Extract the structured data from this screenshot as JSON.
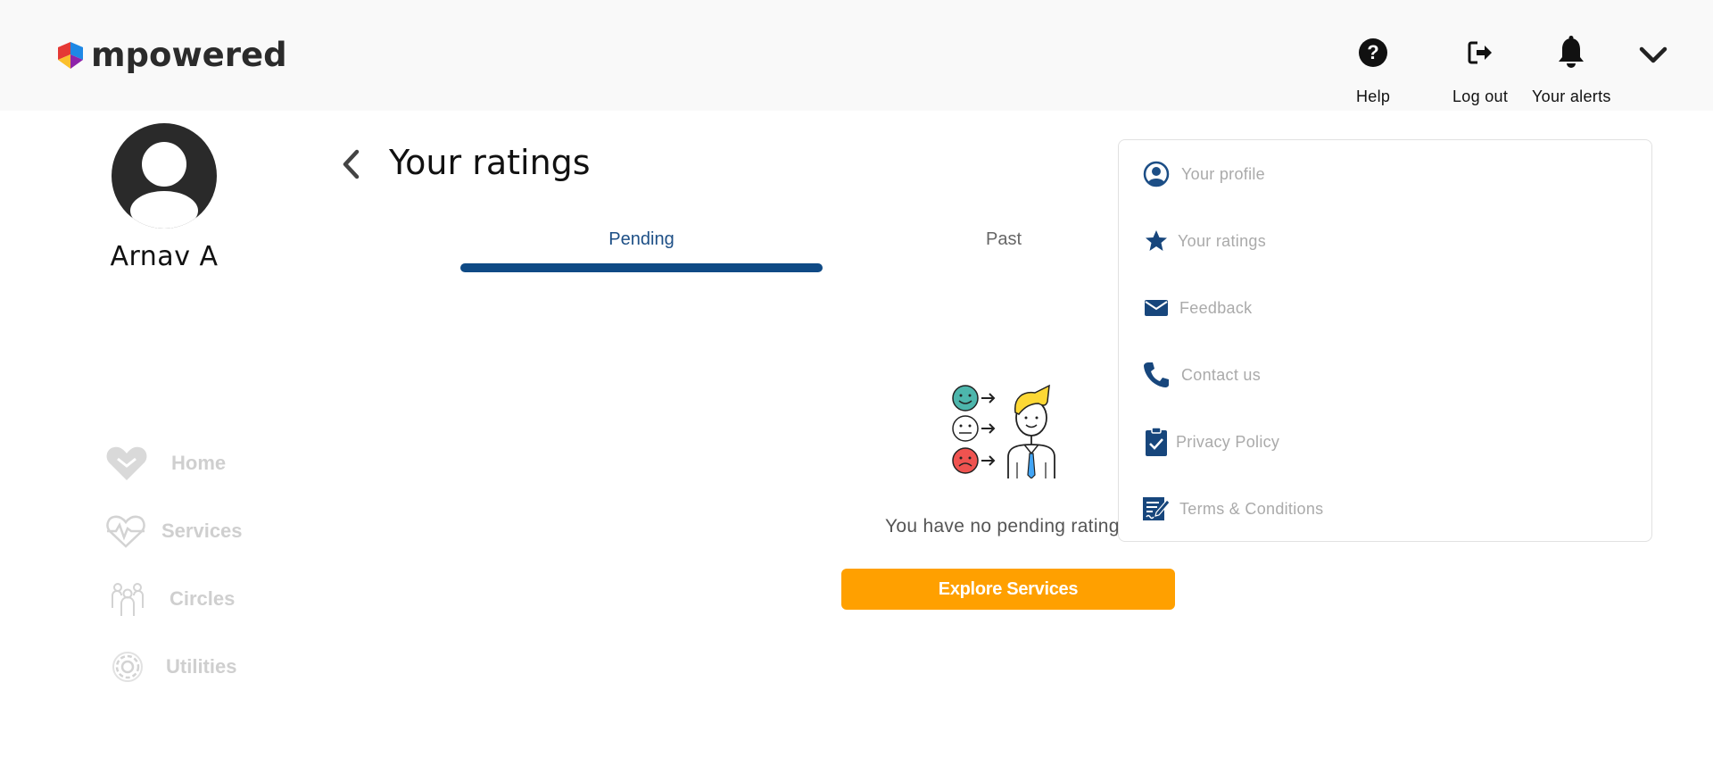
{
  "header": {
    "logo_text": "mpowered",
    "help_label": "Help",
    "logout_label": "Log out",
    "alerts_label": "Your alerts"
  },
  "profile": {
    "name": "Arnav A"
  },
  "nav": {
    "items": [
      {
        "label": "Home",
        "icon": "heart-home-icon"
      },
      {
        "label": "Services",
        "icon": "heart-pulse-icon"
      },
      {
        "label": "Circles",
        "icon": "people-icon"
      },
      {
        "label": "Utilities",
        "icon": "gear-icon"
      }
    ]
  },
  "page": {
    "title": "Your ratings",
    "tabs": [
      {
        "label": "Pending",
        "active": true
      },
      {
        "label": "Past",
        "active": false
      }
    ],
    "empty_text": "You have no pending ratings",
    "explore_button": "Explore Services"
  },
  "dropdown": {
    "items": [
      {
        "label": "Your profile",
        "icon": "user-circle-icon"
      },
      {
        "label": "Your ratings",
        "icon": "star-icon"
      },
      {
        "label": "Feedback",
        "icon": "envelope-icon"
      },
      {
        "label": "Contact us",
        "icon": "phone-icon"
      },
      {
        "label": "Privacy Policy",
        "icon": "clipboard-check-icon"
      },
      {
        "label": "Terms & Conditions",
        "icon": "document-sign-icon"
      }
    ]
  },
  "colors": {
    "accent_blue": "#0f4a85",
    "button_orange": "#ffa000",
    "header_bg": "#f9f9f9",
    "nav_disabled": "#cfcfcf"
  }
}
